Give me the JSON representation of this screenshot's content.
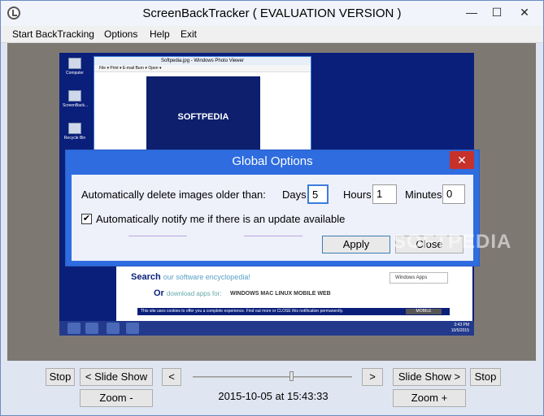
{
  "window": {
    "title": "ScreenBackTracker ( EVALUATION VERSION )",
    "min_glyph": "—",
    "max_glyph": "☐",
    "close_glyph": "✕"
  },
  "menu": {
    "start": "Start BackTracking",
    "options": "Options",
    "help": "Help",
    "exit": "Exit"
  },
  "screenshot": {
    "desktop_icons": [
      "Computer",
      "ScreenBack...",
      "Recycle Bin"
    ],
    "photo_viewer_title": "Softpedia.jpg - Windows Photo Viewer",
    "photo_viewer_menu": "File  ▾   Print  ▾   E-mail   Burn  ▾   Open  ▾",
    "logo": "SOFTPEDIA",
    "site_search": "Search",
    "site_search_sub": "our software encyclopedia!",
    "site_or": "Or",
    "site_or_sub": "download apps for:",
    "site_os": "WINDOWS   MAC   LINUX   MOBILE   WEB",
    "site_select": "Windows Apps",
    "site_banner": "This site uses cookies to offer you a complete experience. Find out more or CLOSE this notification permanently.",
    "site_banner_mobile": "MOBILE",
    "clock_time": "3:43 PM",
    "clock_date": "10/5/2015"
  },
  "dialog": {
    "title": "Global Options",
    "close_glyph": "✕",
    "delete_label": "Automatically delete images older than:",
    "days_label": "Days",
    "days_value": "5",
    "hours_label": "Hours",
    "hours_value": "1",
    "minutes_label": "Minutes",
    "minutes_value": "0",
    "notify_checked": true,
    "notify_glyph": "✔",
    "notify_label": "Automatically notify me if there is an update available",
    "apply": "Apply",
    "close": "Close"
  },
  "watermark": "SOFTPEDIA",
  "controls": {
    "stop_left": "Stop",
    "slideshow_back": "< Slide Show",
    "prev": "<",
    "next": ">",
    "slideshow_forward": "Slide Show >",
    "stop_right": "Stop",
    "zoom_out": "Zoom -",
    "zoom_in": "Zoom +",
    "timestamp": "2015-10-05 at 15:43:33",
    "slider_position": 0.62
  }
}
